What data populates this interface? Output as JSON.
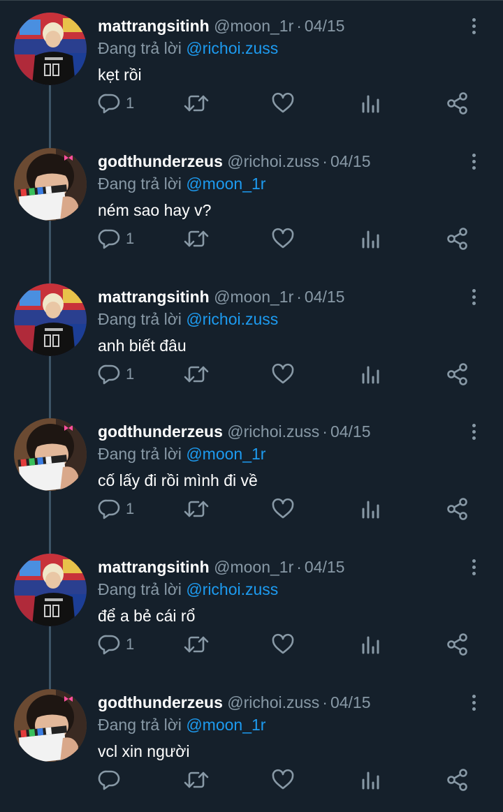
{
  "reply_prefix": "Đang trả lời",
  "colors": {
    "background": "#15202b",
    "muted": "#8899a6",
    "link": "#1d9bf0",
    "thread_line": "#3d5466"
  },
  "icons": {
    "more": "more-vertical-icon",
    "reply": "reply-icon",
    "retweet": "retweet-icon",
    "like": "heart-icon",
    "analytics": "analytics-icon",
    "share": "share-icon"
  },
  "tweets": [
    {
      "name": "mattrangsitinh",
      "handle": "@moon_1r",
      "date": "04/15",
      "reply_to": "@richoi.zuss",
      "text": "kẹt rồi",
      "reply_count": "1",
      "avatar": "jersey-avatar"
    },
    {
      "name": "godthunderzeus",
      "handle": "@richoi.zuss",
      "date": "04/15",
      "reply_to": "@moon_1r",
      "text": "ném sao hay v?",
      "reply_count": "1",
      "avatar": "clapper-avatar"
    },
    {
      "name": "mattrangsitinh",
      "handle": "@moon_1r",
      "date": "04/15",
      "reply_to": "@richoi.zuss",
      "text": "anh biết đâu",
      "reply_count": "1",
      "avatar": "jersey-avatar"
    },
    {
      "name": "godthunderzeus",
      "handle": "@richoi.zuss",
      "date": "04/15",
      "reply_to": "@moon_1r",
      "text": "cố lấy đi rồi mình đi về",
      "reply_count": "1",
      "avatar": "clapper-avatar"
    },
    {
      "name": "mattrangsitinh",
      "handle": "@moon_1r",
      "date": "04/15",
      "reply_to": "@richoi.zuss",
      "text": "để a bẻ cái rổ",
      "reply_count": "1",
      "avatar": "jersey-avatar"
    },
    {
      "name": "godthunderzeus",
      "handle": "@richoi.zuss",
      "date": "04/15",
      "reply_to": "@moon_1r",
      "text": "vcl xin người",
      "reply_count": "",
      "avatar": "clapper-avatar"
    }
  ]
}
